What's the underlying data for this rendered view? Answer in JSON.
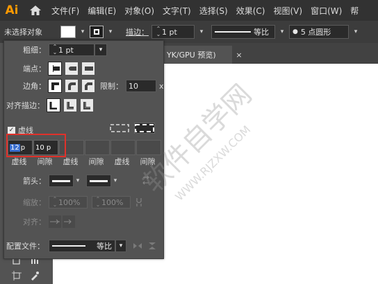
{
  "app": {
    "logo": "Ai"
  },
  "menu": [
    "文件(F)",
    "编辑(E)",
    "对象(O)",
    "文字(T)",
    "选择(S)",
    "效果(C)",
    "视图(V)",
    "窗口(W)",
    "帮"
  ],
  "control": {
    "selection": "未选择对象",
    "stroke_label": "描边：",
    "stroke_weight": "1 pt",
    "profile_label": "等比",
    "brush_label": "5 点圆形"
  },
  "doc_tab": {
    "title": "YK/GPU 预览)",
    "close": "×"
  },
  "stroke_panel": {
    "weight_label": "粗细：",
    "weight_value": "1 pt",
    "cap_label": "端点：",
    "corner_label": "边角：",
    "limit_label": "限制：",
    "limit_value": "10",
    "limit_unit": "x",
    "align_label": "对齐描边：",
    "dashed_label": "虚线",
    "dashed_checked": true,
    "dash1_value": "12",
    "dash1_unit": "p",
    "gap1_value": "10 p",
    "dash_sublabels": [
      "虚线",
      "间隙",
      "虚线",
      "间隙",
      "虚线",
      "间隙"
    ],
    "arrow_label": "箭头：",
    "scale_label": "缩放：",
    "scale1": "100%",
    "scale2": "100%",
    "align2_label": "对齐：",
    "profile_label": "配置文件：",
    "profile_value": "等比"
  },
  "watermark": {
    "text": "软件自学网",
    "url": "WWW.RJZXW.COM"
  }
}
